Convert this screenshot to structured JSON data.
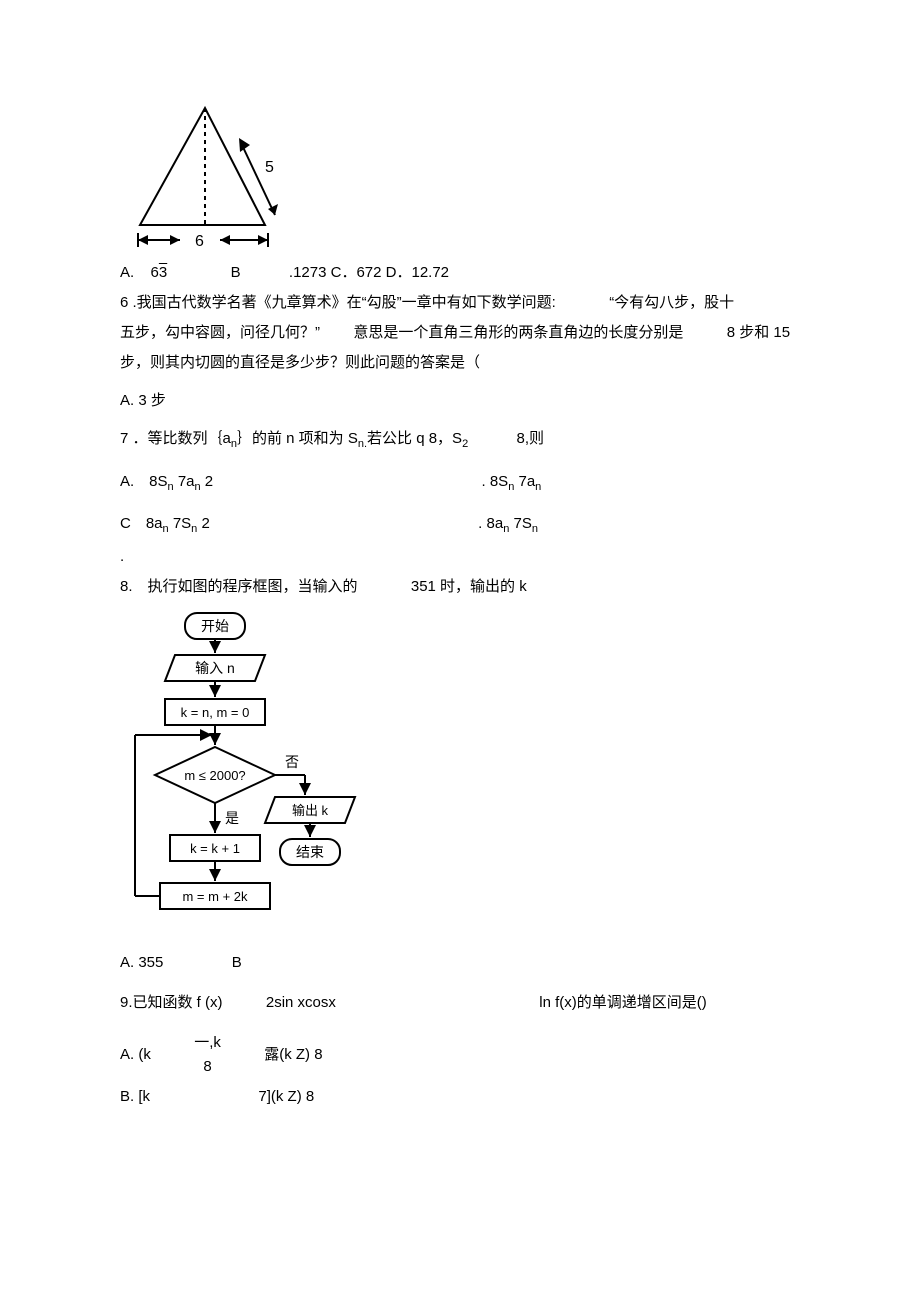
{
  "q5_figure": {
    "side_label": "5",
    "base_label": "6"
  },
  "q5_options": {
    "a_prefix": "A.",
    "a_value_pre": "6",
    "a_value_sqrt": "3",
    "b_prefix": "B",
    "rest": ".1273 C．672 D．12.72"
  },
  "q6": {
    "line1_pre": "6 .我国古代数学名著《九章算术》在“勾股”一章中有如下数学问题:",
    "line1_tail": "“今有勾八步，股十",
    "line2_pre": "五步，勾中容圆，问径几何？”",
    "line2_mid": "意思是一个直角三角形的两条直角边的长度分别是",
    "line2_tail": "8 步和 15",
    "line3": "步，则其内切圆的直径是多少步？则此问题的答案是（",
    "opt_a": "A. 3 步"
  },
  "q7": {
    "stem_pre": "7 ．等比数列｛a",
    "stem_sub1": "n",
    "stem_mid1": "｝的前 n 项和为 S",
    "stem_sub2": "n.",
    "stem_mid2": "若公比 q 8，S",
    "stem_sub3": "2",
    "stem_tail": "8,则",
    "optA_pre": "A.　8S",
    "optA_sub1": "n",
    "optA_mid": " 7a",
    "optA_sub2": "n",
    "optA_tail": " 2",
    "optB_pre": ". 8S",
    "optB_sub1": "n",
    "optB_mid": " 7a",
    "optB_sub2": "n",
    "optC_pre": "C　8a",
    "optC_sub1": "n",
    "optC_mid": " 7S",
    "optC_sub2": "n",
    "optC_tail": " 2",
    "optD_pre": ". 8a",
    "optD_sub1": "n",
    "optD_mid": " 7S",
    "optD_sub2": "n",
    "cdot": "."
  },
  "q8": {
    "stem_pre": "8.　执行如图的程序框图，当输入的",
    "stem_mid": "351 时，输出的 k",
    "flow": {
      "start": "开始",
      "input": "输入 n",
      "init": "k = n, m = 0",
      "cond": "m ≤ 2000?",
      "no": "否",
      "yes": "是",
      "output": "输出 k",
      "end": "结束",
      "step1": "k = k + 1",
      "step2": "m = m + 2k"
    },
    "opt_a": "A. 355",
    "opt_b": "B"
  },
  "q9": {
    "stem_pre": "9.已知函数 f (x)",
    "stem_mid": "2sin xcosx",
    "stem_tail": "ln f(x)的单调递增区间是()",
    "optA_pre": "A. (k",
    "optA_mid": "一,k",
    "optA_tail": "露(k Z) 8",
    "optA_denom": "8",
    "optB_pre": "B. [k",
    "optB_tail": "7](k Z) 8"
  }
}
